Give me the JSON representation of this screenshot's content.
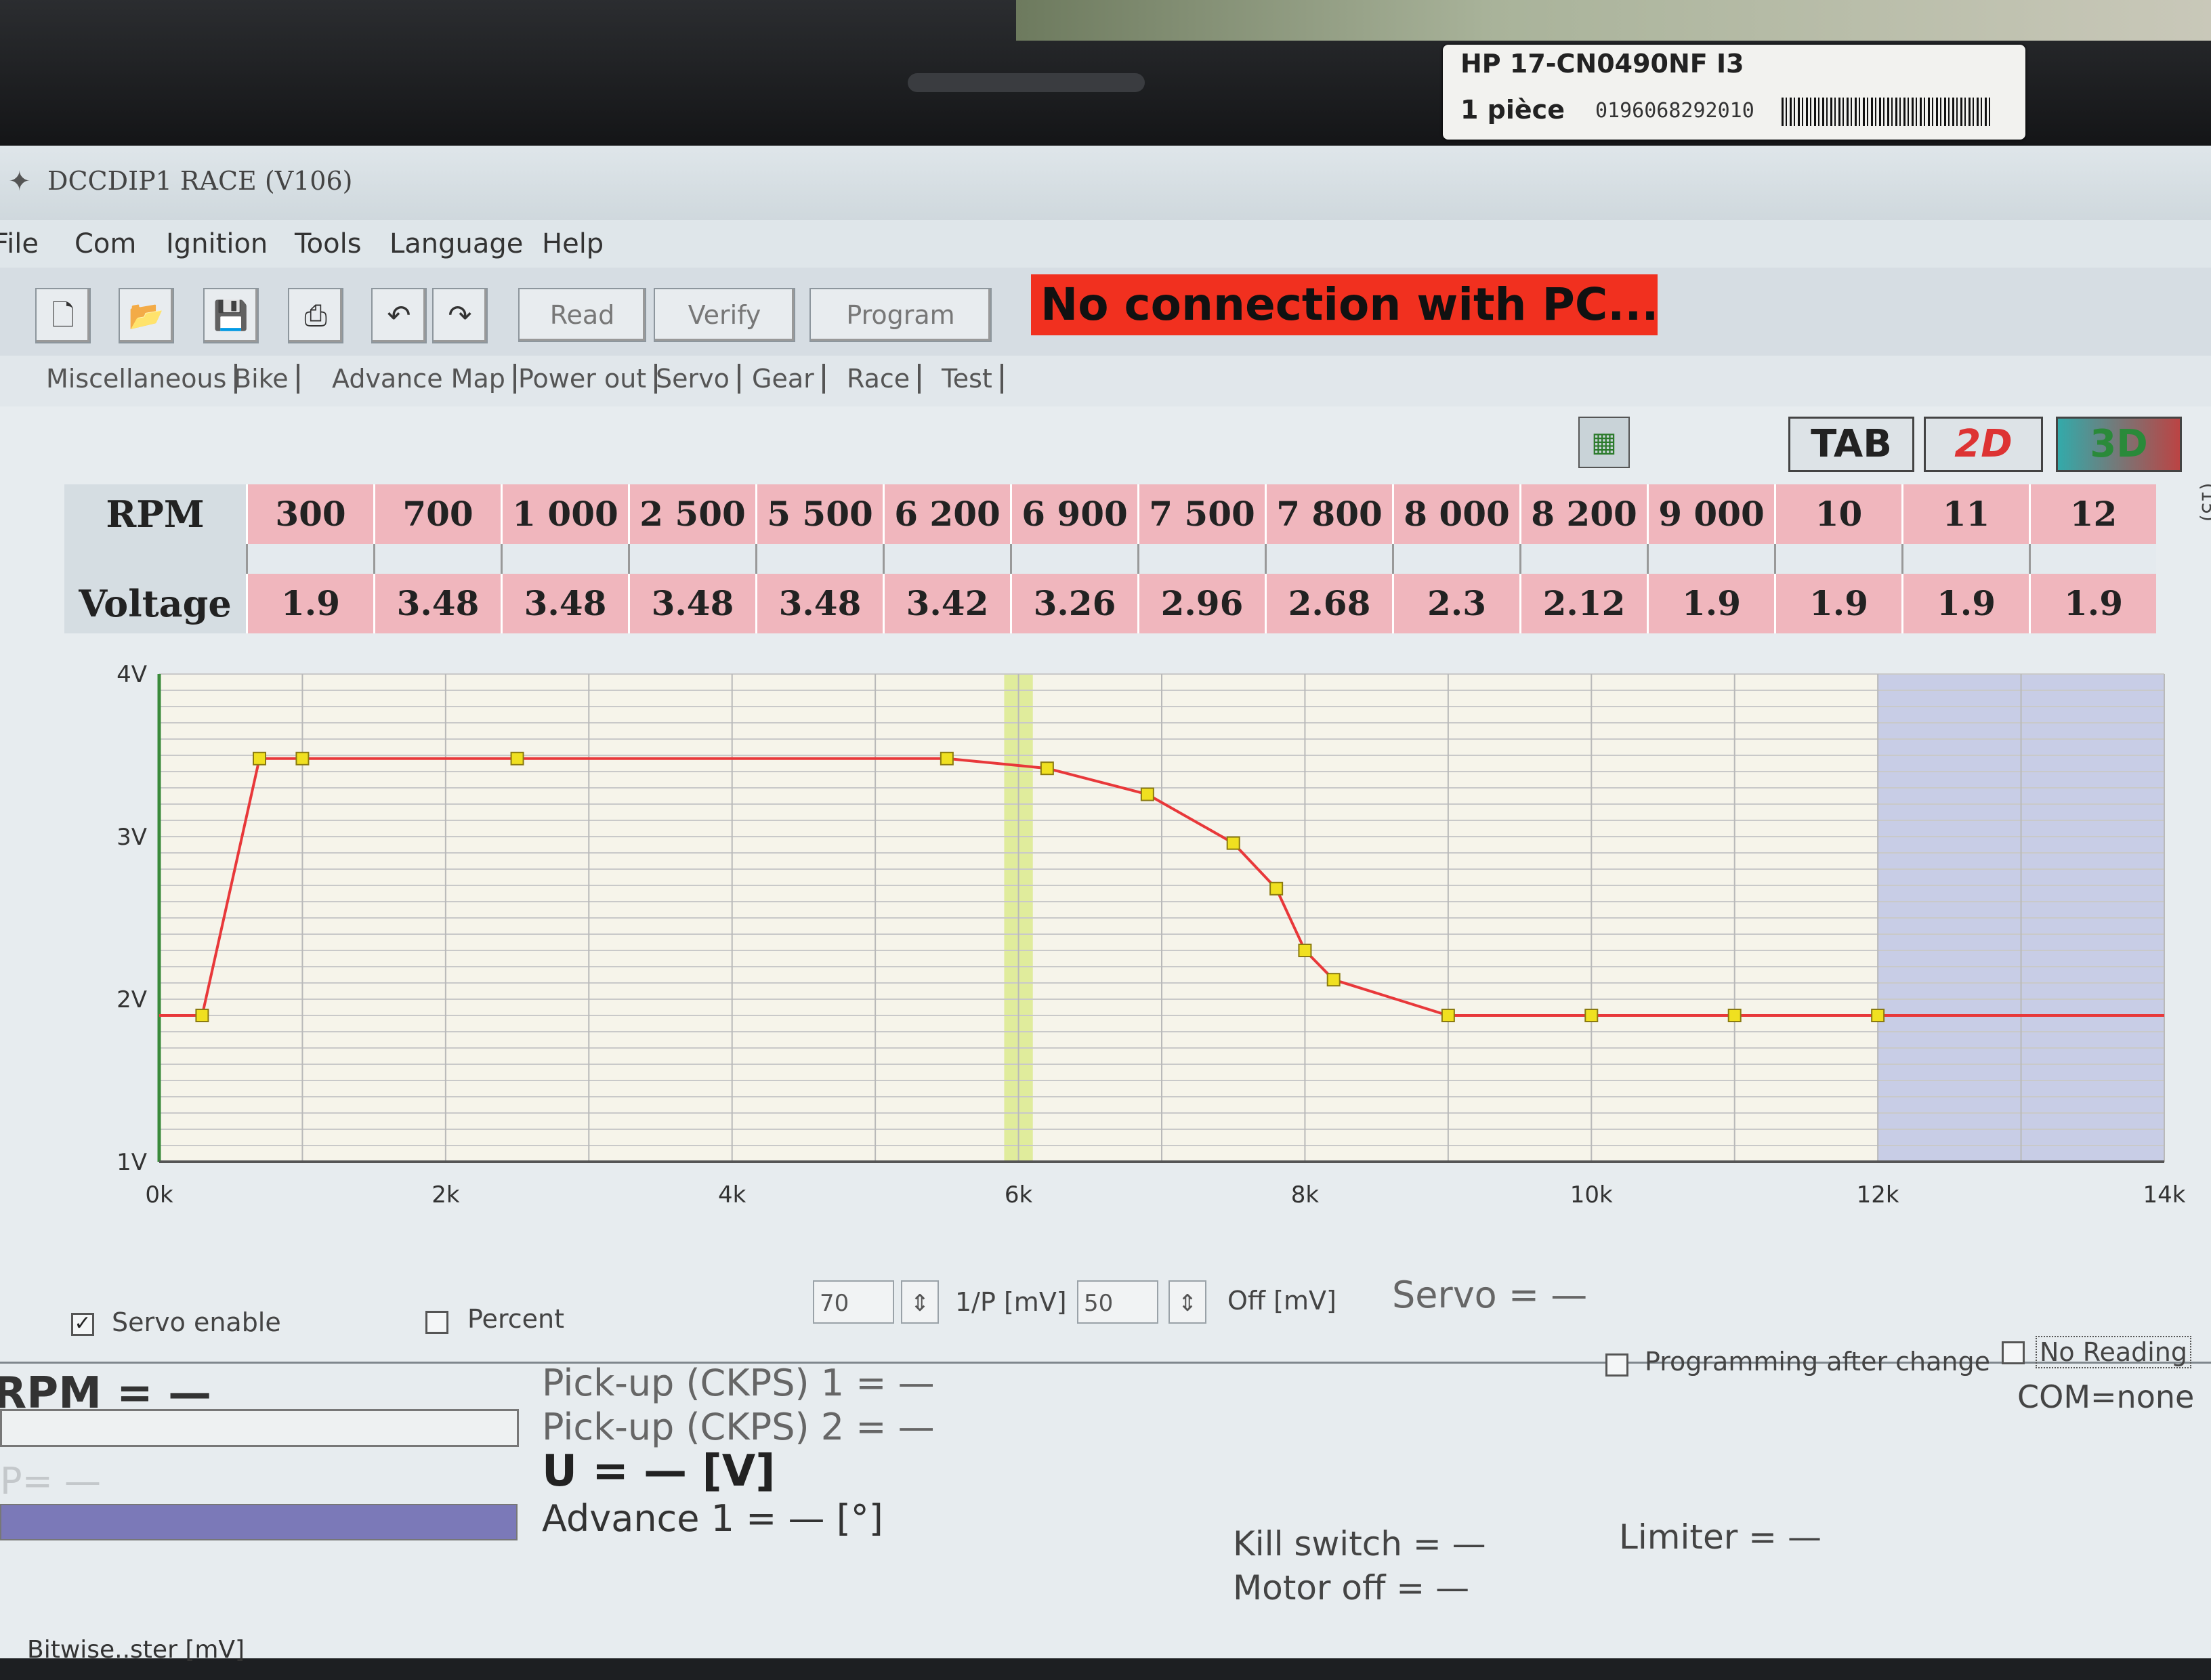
{
  "sticker": {
    "model": "HP 17-CN0490NF I3",
    "qty": "1 pièce",
    "code": "0196068292010"
  },
  "window": {
    "title": "DCCDIP1 RACE (V106)"
  },
  "menu": [
    "File",
    "Com",
    "Ignition",
    "Tools",
    "Language",
    "Help"
  ],
  "toolbar": {
    "icons": [
      "new-file-icon",
      "open-folder-icon",
      "save-icon",
      "print-icon",
      "undo-icon",
      "redo-icon"
    ],
    "read_label": "Read",
    "verify_label": "Verify",
    "program_label": "Program"
  },
  "status": {
    "message": "No connection with PC..."
  },
  "tabs": [
    "Miscellaneous",
    "Bike",
    "Advance Map",
    "Power out",
    "Servo",
    "Gear",
    "Race",
    "Test"
  ],
  "view_buttons": {
    "tab": "TAB",
    "two_d": "2D",
    "three_d": "3D"
  },
  "table": {
    "rpm_label": "RPM",
    "voltage_label": "Voltage",
    "rpm": [
      "300",
      "700",
      "1 000",
      "2 500",
      "5 500",
      "6 200",
      "6 900",
      "7 500",
      "7 800",
      "8 000",
      "8 200",
      "9 000",
      "10 000",
      "11 000",
      "12 000"
    ],
    "voltage": [
      "1.9",
      "3.48",
      "3.48",
      "3.48",
      "3.48",
      "3.42",
      "3.26",
      "2.96",
      "2.68",
      "2.3",
      "2.12",
      "1.9",
      "1.9",
      "1.9",
      "1.9"
    ],
    "side_label": "(15)"
  },
  "chart_data": {
    "type": "line",
    "title": "",
    "xlabel": "",
    "ylabel": "",
    "x": [
      0,
      300,
      700,
      1000,
      2500,
      5500,
      6200,
      6900,
      7500,
      7800,
      8000,
      8200,
      9000,
      10000,
      11000,
      12000,
      14000
    ],
    "y": [
      1.9,
      1.9,
      3.48,
      3.48,
      3.48,
      3.48,
      3.42,
      3.26,
      2.96,
      2.68,
      2.3,
      2.12,
      1.9,
      1.9,
      1.9,
      1.9,
      1.9
    ],
    "markers_x": [
      300,
      700,
      1000,
      2500,
      5500,
      6200,
      6900,
      7500,
      7800,
      8000,
      8200,
      9000,
      10000,
      11000,
      12000
    ],
    "xlim": [
      0,
      14000
    ],
    "ylim": [
      1,
      4
    ],
    "x_ticks": [
      "0k",
      "2k",
      "4k",
      "6k",
      "8k",
      "10k",
      "12k",
      "14k"
    ],
    "y_ticks": [
      "1V",
      "2V",
      "3V",
      "4V"
    ],
    "grid": true,
    "line_color": "#e8383a",
    "marker_color": "#f0e020",
    "shaded_from_x": 12000
  },
  "controls": {
    "servo_enable": "Servo enable",
    "servo_enable_checked": true,
    "percent": "Percent",
    "percent_checked": false,
    "spin1_value": "70",
    "spin1_unit": "1/P [mV]",
    "spin2_value": "50",
    "spin2_unit": "Off [mV]",
    "servo_readout": "Servo = —"
  },
  "readouts": {
    "rpm": "RPM = —",
    "p": "P= —",
    "pickup1": "Pick-up (CKPS) 1 = —",
    "pickup2": "Pick-up (CKPS) 2 = —",
    "u": "U = — [V]",
    "advance": "Advance 1 = — [°]",
    "programming_after_change": "Programming after change",
    "no_reading": "No Reading",
    "com": "COM=none",
    "kill_switch": "Kill switch = —",
    "motor_off": "Motor off = —",
    "limiter": "Limiter = —",
    "bottom_cut": "Bitwise..ster   [mV]"
  }
}
